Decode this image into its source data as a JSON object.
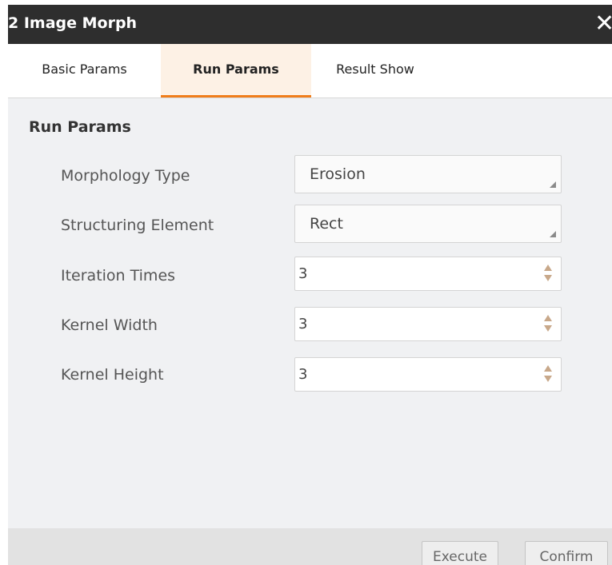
{
  "window": {
    "title": "2 Image Morph",
    "close_icon": "close-icon"
  },
  "tabs": [
    {
      "label": "Basic Params",
      "active": false
    },
    {
      "label": "Run Params",
      "active": true
    },
    {
      "label": "Result Show",
      "active": false
    }
  ],
  "section": {
    "heading": "Run Params"
  },
  "fields": {
    "morphology_type": {
      "label": "Morphology Type",
      "value": "Erosion"
    },
    "structuring_element": {
      "label": "Structuring Element",
      "value": "Rect"
    },
    "iteration_times": {
      "label": "Iteration Times",
      "value": "3"
    },
    "kernel_width": {
      "label": "Kernel Width",
      "value": "3"
    },
    "kernel_height": {
      "label": "Kernel Height",
      "value": "3"
    }
  },
  "footer": {
    "execute_label": "Execute",
    "confirm_label": "Confirm"
  },
  "colors": {
    "titlebar": "#2e2e2e",
    "active_tab_bg": "#fdf1e5",
    "active_tab_underline": "#f07d1a",
    "panel_bg": "#f0f1f3"
  }
}
